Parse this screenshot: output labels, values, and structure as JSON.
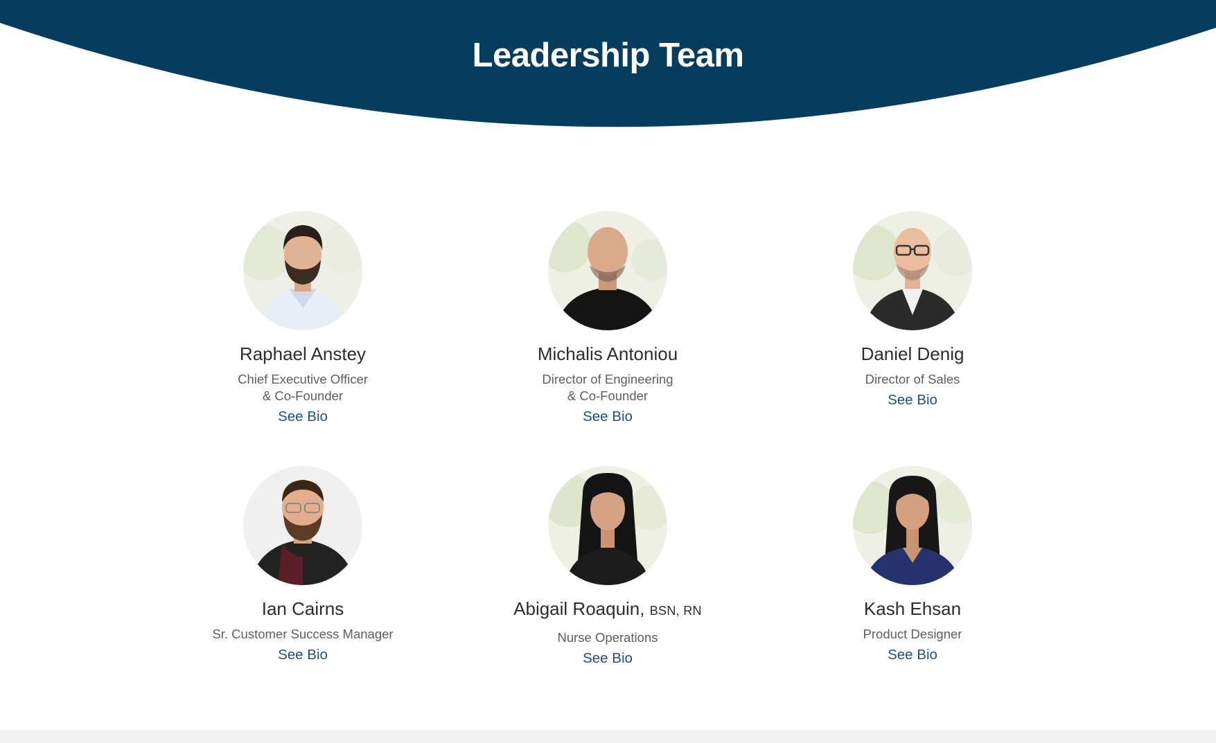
{
  "hero": {
    "title": "Leadership Team",
    "color": "#063d5e"
  },
  "members": [
    {
      "name": "Raphael Anstey",
      "credentials": "",
      "role_lines": [
        "Chief Executive Officer",
        "& Co-Founder"
      ],
      "link": "See Bio",
      "avatar": "portrait-man-beard-white-shirt"
    },
    {
      "name": "Michalis Antoniou",
      "credentials": "",
      "role_lines": [
        "Director of Engineering",
        "& Co-Founder"
      ],
      "link": "See Bio",
      "avatar": "portrait-man-bald-black-shirt"
    },
    {
      "name": "Daniel Denig",
      "credentials": "",
      "role_lines": [
        "Director of Sales"
      ],
      "link": "See Bio",
      "avatar": "portrait-man-glasses-suit"
    },
    {
      "name": "Ian Cairns",
      "credentials": "",
      "role_lines": [
        "Sr. Customer Success Manager"
      ],
      "link": "See Bio",
      "avatar": "portrait-man-glasses-beard"
    },
    {
      "name": "Abigail Roaquin,",
      "credentials": "BSN, RN",
      "role_lines": [
        "Nurse Operations"
      ],
      "link": "See Bio",
      "avatar": "portrait-woman-black-hair"
    },
    {
      "name": "Kash Ehsan",
      "credentials": "",
      "role_lines": [
        "Product Designer"
      ],
      "link": "See Bio",
      "avatar": "portrait-woman-navy-top"
    }
  ]
}
